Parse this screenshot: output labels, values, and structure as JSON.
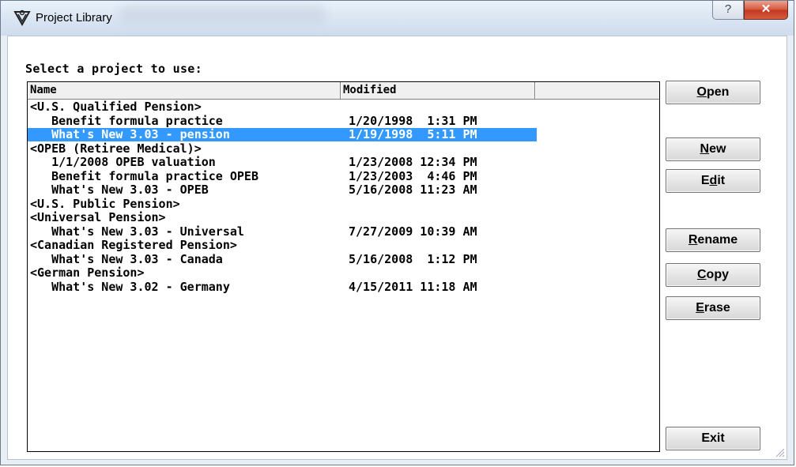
{
  "window": {
    "title": "Project Library",
    "help_label": "?",
    "close_label": "✕"
  },
  "prompt": "Select a project to use:",
  "columns": [
    "Name",
    "Modified",
    ""
  ],
  "rows": [
    {
      "name": "<U.S. Qualified Pension>",
      "modified": ""
    },
    {
      "name": "   Benefit formula practice",
      "modified": "1/20/1998  1:31 PM"
    },
    {
      "name": "   What's New 3.03 - pension",
      "modified": "1/19/1998  5:11 PM",
      "selected": true
    },
    {
      "name": "<OPEB (Retiree Medical)>",
      "modified": ""
    },
    {
      "name": "   1/1/2008 OPEB valuation",
      "modified": "1/23/2008 12:34 PM"
    },
    {
      "name": "   Benefit formula practice OPEB",
      "modified": "1/23/2003  4:46 PM"
    },
    {
      "name": "   What's New 3.03 - OPEB",
      "modified": "5/16/2008 11:23 AM"
    },
    {
      "name": "<U.S. Public Pension>",
      "modified": ""
    },
    {
      "name": "<Universal Pension>",
      "modified": ""
    },
    {
      "name": "   What's New 3.03 - Universal",
      "modified": "7/27/2009 10:39 AM"
    },
    {
      "name": "<Canadian Registered Pension>",
      "modified": ""
    },
    {
      "name": "   What's New 3.03 - Canada",
      "modified": "5/16/2008  1:12 PM"
    },
    {
      "name": "<German Pension>",
      "modified": ""
    },
    {
      "name": "   What's New 3.02 - Germany",
      "modified": "4/15/2011 11:18 AM"
    }
  ],
  "buttons": {
    "open": {
      "mnemonic": "O",
      "rest": "pen"
    },
    "new": {
      "mnemonic": "N",
      "rest": "ew"
    },
    "edit": {
      "pre": "E",
      "mnemonic": "d",
      "rest": "it"
    },
    "rename": {
      "mnemonic": "R",
      "rest": "ename"
    },
    "copy": {
      "mnemonic": "C",
      "rest": "opy"
    },
    "erase": {
      "mnemonic": "E",
      "rest": "rase"
    },
    "exit": {
      "label": "Exit"
    }
  },
  "colors": {
    "selection": "#3399ff",
    "close_button": "#c3381f"
  }
}
